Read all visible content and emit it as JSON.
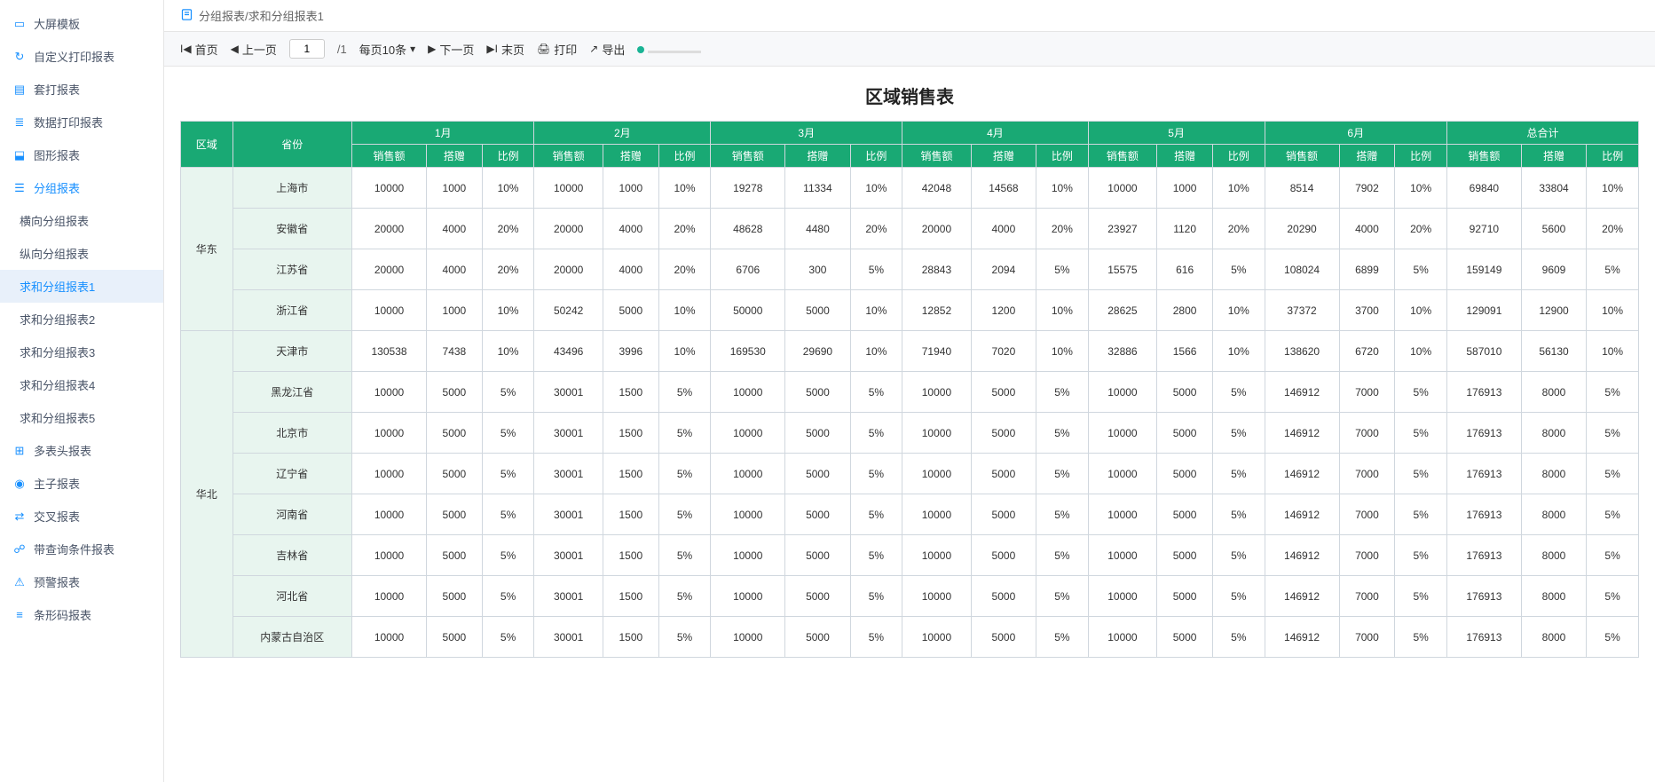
{
  "sidebar": {
    "items": [
      {
        "label": "大屏模板",
        "icon": "screen"
      },
      {
        "label": "自定义打印报表",
        "icon": "refresh"
      },
      {
        "label": "套打报表",
        "icon": "layers"
      },
      {
        "label": "数据打印报表",
        "icon": "stack"
      },
      {
        "label": "图形报表",
        "icon": "chart"
      },
      {
        "label": "分组报表",
        "icon": "doc",
        "active": true
      },
      {
        "label": "多表头报表",
        "icon": "grid"
      },
      {
        "label": "主子报表",
        "icon": "globe"
      },
      {
        "label": "交叉报表",
        "icon": "swap"
      },
      {
        "label": "带查询条件报表",
        "icon": "filter"
      },
      {
        "label": "预警报表",
        "icon": "warn"
      },
      {
        "label": "条形码报表",
        "icon": "barcode"
      }
    ],
    "subItems": [
      {
        "label": "横向分组报表"
      },
      {
        "label": "纵向分组报表"
      },
      {
        "label": "求和分组报表1",
        "selected": true
      },
      {
        "label": "求和分组报表2"
      },
      {
        "label": "求和分组报表3"
      },
      {
        "label": "求和分组报表4"
      },
      {
        "label": "求和分组报表5"
      }
    ]
  },
  "breadcrumb": "分组报表/求和分组报表1",
  "toolbar": {
    "first": "首页",
    "prev": "上一页",
    "page_current": "1",
    "page_total": "/1",
    "page_size": "每页10条",
    "next": "下一页",
    "last": "末页",
    "print": "打印",
    "export": "导出"
  },
  "report": {
    "title": "区域销售表",
    "header": {
      "region": "区域",
      "province": "省份",
      "months": [
        "1月",
        "2月",
        "3月",
        "4月",
        "5月",
        "6月",
        "总合计"
      ],
      "metrics": [
        "销售额",
        "搭赠",
        "比例"
      ]
    },
    "rows": [
      {
        "region": "华东",
        "rowspan": 4,
        "province": "上海市",
        "cells": [
          "10000",
          "1000",
          "10%",
          "10000",
          "1000",
          "10%",
          "19278",
          "11334",
          "10%",
          "42048",
          "14568",
          "10%",
          "10000",
          "1000",
          "10%",
          "8514",
          "7902",
          "10%",
          "69840",
          "33804",
          "10%"
        ]
      },
      {
        "province": "安徽省",
        "cells": [
          "20000",
          "4000",
          "20%",
          "20000",
          "4000",
          "20%",
          "48628",
          "4480",
          "20%",
          "20000",
          "4000",
          "20%",
          "23927",
          "1120",
          "20%",
          "20290",
          "4000",
          "20%",
          "92710",
          "5600",
          "20%"
        ]
      },
      {
        "province": "江苏省",
        "cells": [
          "20000",
          "4000",
          "20%",
          "20000",
          "4000",
          "20%",
          "6706",
          "300",
          "5%",
          "28843",
          "2094",
          "5%",
          "15575",
          "616",
          "5%",
          "108024",
          "6899",
          "5%",
          "159149",
          "9609",
          "5%"
        ]
      },
      {
        "province": "浙江省",
        "cells": [
          "10000",
          "1000",
          "10%",
          "50242",
          "5000",
          "10%",
          "50000",
          "5000",
          "10%",
          "12852",
          "1200",
          "10%",
          "28625",
          "2800",
          "10%",
          "37372",
          "3700",
          "10%",
          "129091",
          "12900",
          "10%"
        ]
      },
      {
        "region": "华北",
        "rowspan": 8,
        "province": "天津市",
        "cells": [
          "130538",
          "7438",
          "10%",
          "43496",
          "3996",
          "10%",
          "169530",
          "29690",
          "10%",
          "71940",
          "7020",
          "10%",
          "32886",
          "1566",
          "10%",
          "138620",
          "6720",
          "10%",
          "587010",
          "56130",
          "10%"
        ]
      },
      {
        "province": "黑龙江省",
        "cells": [
          "10000",
          "5000",
          "5%",
          "30001",
          "1500",
          "5%",
          "10000",
          "5000",
          "5%",
          "10000",
          "5000",
          "5%",
          "10000",
          "5000",
          "5%",
          "146912",
          "7000",
          "5%",
          "176913",
          "8000",
          "5%"
        ]
      },
      {
        "province": "北京市",
        "cells": [
          "10000",
          "5000",
          "5%",
          "30001",
          "1500",
          "5%",
          "10000",
          "5000",
          "5%",
          "10000",
          "5000",
          "5%",
          "10000",
          "5000",
          "5%",
          "146912",
          "7000",
          "5%",
          "176913",
          "8000",
          "5%"
        ]
      },
      {
        "province": "辽宁省",
        "cells": [
          "10000",
          "5000",
          "5%",
          "30001",
          "1500",
          "5%",
          "10000",
          "5000",
          "5%",
          "10000",
          "5000",
          "5%",
          "10000",
          "5000",
          "5%",
          "146912",
          "7000",
          "5%",
          "176913",
          "8000",
          "5%"
        ]
      },
      {
        "province": "河南省",
        "cells": [
          "10000",
          "5000",
          "5%",
          "30001",
          "1500",
          "5%",
          "10000",
          "5000",
          "5%",
          "10000",
          "5000",
          "5%",
          "10000",
          "5000",
          "5%",
          "146912",
          "7000",
          "5%",
          "176913",
          "8000",
          "5%"
        ]
      },
      {
        "province": "吉林省",
        "cells": [
          "10000",
          "5000",
          "5%",
          "30001",
          "1500",
          "5%",
          "10000",
          "5000",
          "5%",
          "10000",
          "5000",
          "5%",
          "10000",
          "5000",
          "5%",
          "146912",
          "7000",
          "5%",
          "176913",
          "8000",
          "5%"
        ]
      },
      {
        "province": "河北省",
        "cells": [
          "10000",
          "5000",
          "5%",
          "30001",
          "1500",
          "5%",
          "10000",
          "5000",
          "5%",
          "10000",
          "5000",
          "5%",
          "10000",
          "5000",
          "5%",
          "146912",
          "7000",
          "5%",
          "176913",
          "8000",
          "5%"
        ]
      },
      {
        "province": "内蒙古自治区",
        "cells": [
          "10000",
          "5000",
          "5%",
          "30001",
          "1500",
          "5%",
          "10000",
          "5000",
          "5%",
          "10000",
          "5000",
          "5%",
          "10000",
          "5000",
          "5%",
          "146912",
          "7000",
          "5%",
          "176913",
          "8000",
          "5%"
        ]
      }
    ]
  }
}
